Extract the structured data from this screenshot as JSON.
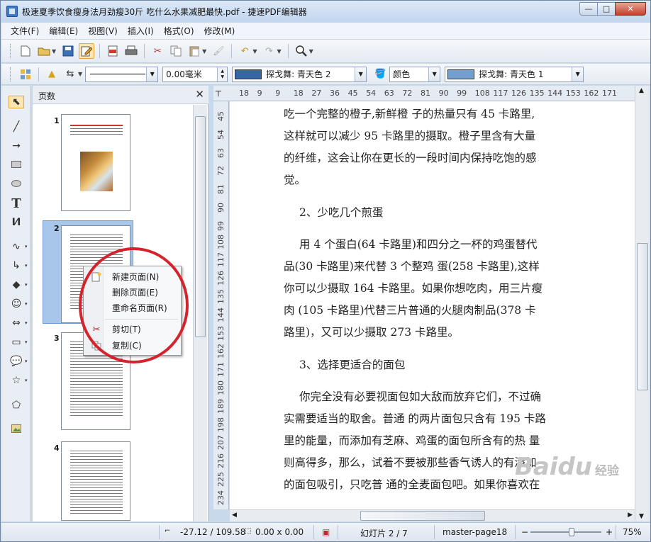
{
  "window": {
    "title": "极速夏季饮食瘦身法月劲瘦30斤 吃什么水果减肥最快.pdf - 捷速PDF编辑器",
    "min_label": "—",
    "max_label": "□",
    "close_label": "✕"
  },
  "menu": [
    "文件(F)",
    "编辑(E)",
    "视图(V)",
    "插入(I)",
    "格式(O)",
    "修改(M)"
  ],
  "toolbar2": {
    "line_width": "0.00毫米",
    "line_color": "探戈舞: 青天色 2",
    "area_style": "颜色",
    "fill_color": "探戈舞: 青天色 1",
    "line_color_hex": "#3465a4",
    "fill_color_hex": "#729fcf"
  },
  "panel": {
    "title": "页数",
    "close": "✕",
    "pages": [
      "1",
      "2",
      "3",
      "4"
    ]
  },
  "context_menu": {
    "items": [
      "新建页面(N)",
      "删除页面(E)",
      "重命名页面(R)",
      "剪切(T)",
      "复制(C)"
    ]
  },
  "ruler": {
    "h_ticks": [
      "18",
      "9",
      "9",
      "18",
      "27",
      "36",
      "45",
      "54",
      "63",
      "72",
      "81",
      "90",
      "99",
      "108",
      "117",
      "126",
      "135",
      "144",
      "153",
      "162",
      "171"
    ],
    "v_ticks": [
      "45",
      "54",
      "63",
      "72",
      "81",
      "90",
      "99",
      "108",
      "117",
      "126",
      "135",
      "144",
      "153",
      "162",
      "171",
      "180",
      "189",
      "198",
      "207",
      "216",
      "225",
      "234"
    ]
  },
  "document": {
    "paragraphs": [
      "吃一个完整的橙子,新鲜橙 子的热量只有 45 卡路里,",
      "这样就可以减少 95 卡路里的摄取。橙子里含有大量",
      "的纤维，这会让你在更长的一段时间内保持吃饱的感",
      "觉。",
      "2、少吃几个煎蛋",
      "用 4 个蛋白(64 卡路里)和四分之一杯的鸡蛋替代",
      "品(30 卡路里)来代替 3 个整鸡 蛋(258 卡路里),这样",
      "你可以少摄取 164 卡路里。如果你想吃肉，用三片瘦",
      "肉 (105 卡路里)代替三片普通的火腿肉制品(378 卡",
      "路里)，又可以少摄取 273 卡路里。",
      "3、选择更适合的面包",
      "你完全没有必要视面包如大敌而放弃它们，不过确",
      "实需要适当的取舍。普通 的两片面包只含有 195 卡路",
      "里的能量，而添加有芝麻、鸡蛋的面包所含有的热 量",
      "则高得多，那么，试着不要被那些香气诱人的有添加",
      "的面包吸引，只吃普 通的全麦面包吧。如果你喜欢在"
    ]
  },
  "status": {
    "position": "-27.12 / 109.58",
    "size": "0.00 x 0.00",
    "slide": "幻灯片 2 / 7",
    "master": "master-page18",
    "zoom_minus": "−",
    "zoom_plus": "+",
    "zoom": "75%",
    "zoom_level": 0.58
  },
  "watermark": {
    "brand": "Baidu",
    "sub": "经验"
  }
}
